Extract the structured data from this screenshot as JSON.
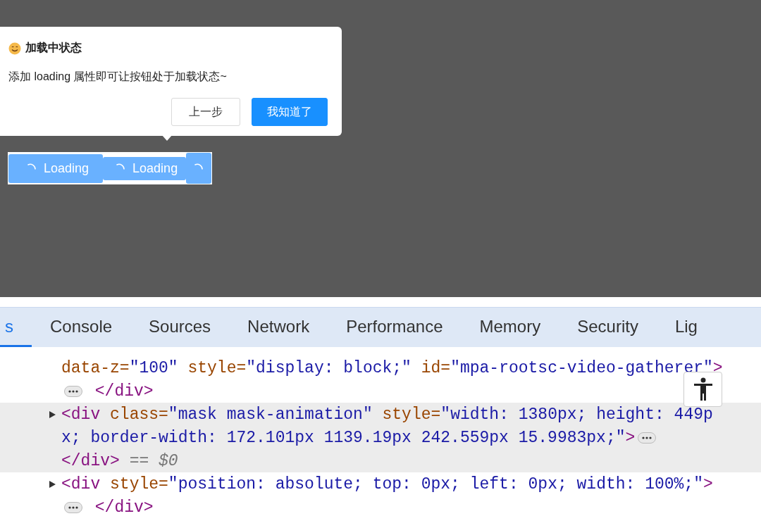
{
  "popover": {
    "title": "加载中状态",
    "description": "添加 loading 属性即可让按钮处于加载状态~",
    "buttons": [
      {
        "label": "上一步",
        "kind": "default"
      },
      {
        "label": "我知道了",
        "kind": "primary"
      }
    ]
  },
  "loading_buttons": [
    {
      "label": "Loading",
      "loading": true
    },
    {
      "label": "Loading",
      "loading": true
    },
    {
      "loading": true
    }
  ],
  "devtools": {
    "tabs": [
      {
        "label": "s",
        "selected": true
      },
      {
        "label": "Console",
        "selected": false
      },
      {
        "label": "Sources",
        "selected": false
      },
      {
        "label": "Network",
        "selected": false
      },
      {
        "label": "Performance",
        "selected": false
      },
      {
        "label": "Memory",
        "selected": false
      },
      {
        "label": "Security",
        "selected": false
      },
      {
        "label": "Lig",
        "selected": false
      }
    ],
    "nodes": [
      {
        "selected": false,
        "lines": [
          [
            {
              "kind": "attr",
              "text": "data-z="
            },
            {
              "kind": "value",
              "text": "\"100\""
            },
            {
              "kind": "attr",
              "text": " style="
            },
            {
              "kind": "value",
              "text": "\"display: block;\""
            },
            {
              "kind": "attr",
              "text": " id="
            },
            {
              "kind": "value",
              "text": "\"mpa-rootsc-video-gatherer\""
            },
            {
              "kind": "tag",
              "text": ">"
            }
          ],
          [
            {
              "kind": "ellipsis"
            },
            {
              "kind": "tag",
              "text": " </div>"
            }
          ]
        ]
      },
      {
        "selected": true,
        "expanded": false,
        "lines": [
          [
            {
              "kind": "tag",
              "text": "<div"
            },
            {
              "kind": "attr",
              "text": " class="
            },
            {
              "kind": "value",
              "text": "\"mask mask-animation\""
            },
            {
              "kind": "attr",
              "text": " style="
            },
            {
              "kind": "value",
              "text": "\"width: 1380px; height: 449p"
            }
          ],
          [
            {
              "kind": "value",
              "text": "x; border-width: 172.101px 1139.19px 242.559px 15.9983px;\""
            },
            {
              "kind": "tag",
              "text": ">"
            },
            {
              "kind": "ellipsis"
            }
          ],
          [
            {
              "kind": "tag",
              "text": "</div>"
            },
            {
              "kind": "ref",
              "text": " == $0"
            }
          ]
        ]
      },
      {
        "selected": false,
        "expanded": false,
        "lines": [
          [
            {
              "kind": "tag",
              "text": "<div"
            },
            {
              "kind": "attr",
              "text": " style="
            },
            {
              "kind": "value",
              "text": "\"position: absolute; top: 0px; left: 0px; width: 100%;\""
            },
            {
              "kind": "tag",
              "text": ">"
            }
          ],
          [
            {
              "kind": "ellipsis"
            },
            {
              "kind": "tag",
              "text": " </div>"
            }
          ]
        ]
      }
    ]
  }
}
